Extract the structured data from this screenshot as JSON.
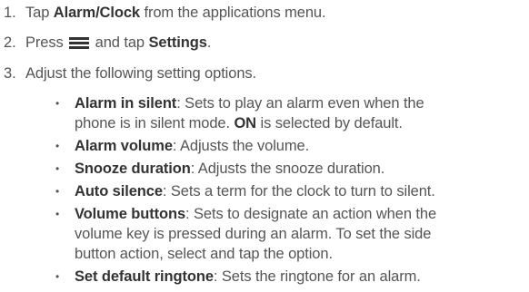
{
  "steps": [
    {
      "number": "1.",
      "prefix": "Tap ",
      "bold": "Alarm/Clock",
      "suffix": " from the applications menu."
    },
    {
      "number": "2.",
      "prefix": "Press ",
      "icon": "menu-icon",
      "mid": " and tap ",
      "bold": "Settings",
      "suffix": "."
    },
    {
      "number": "3.",
      "text": "Adjust the following setting options."
    }
  ],
  "options": [
    {
      "term": "Alarm in silent",
      "line1": ": Sets to play an alarm even when the",
      "line2_prefix": "phone is in silent mode. ",
      "line2_bold": "ON",
      "line2_suffix": " is selected by default."
    },
    {
      "term": "Alarm volume",
      "line1": ": Adjusts the volume."
    },
    {
      "term": "Snooze duration",
      "line1": ": Adjusts the snooze duration."
    },
    {
      "term": "Auto silence",
      "line1": ": Sets a term for the clock to turn to silent."
    },
    {
      "term": "Volume buttons",
      "line1": ": Sets to designate an action when the",
      "line2": "volume key is pressed during an alarm. To set the side",
      "line3": "button action, select and tap the option."
    },
    {
      "term": "Set default ringtone",
      "line1": ": Sets the ringtone for an alarm."
    }
  ],
  "bullet": "•",
  "colors": {
    "text": "#555555",
    "bold": "#333333"
  }
}
